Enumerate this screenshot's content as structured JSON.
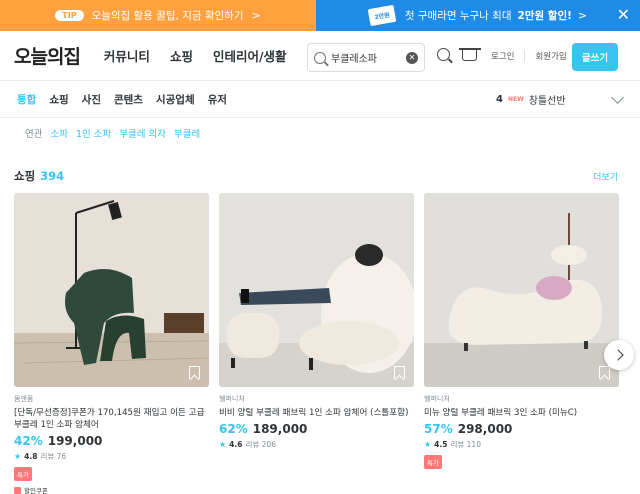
{
  "banners": {
    "left": {
      "tip": "TIP",
      "text": "오늘의집 활용 꿀팁, 지금 확인하기",
      "chevron": ">"
    },
    "right": {
      "coupon_label": "2만원",
      "text": "첫 구매라면 누구나 최대 ",
      "highlight": "2만원 할인!",
      "chevron": ">",
      "close": "✕"
    }
  },
  "header": {
    "logo": "오늘의집",
    "nav": [
      "커뮤니티",
      "쇼핑",
      "인테리어/생활"
    ],
    "search": {
      "value": "부클레소파",
      "clear": "✕"
    },
    "login": "로그인",
    "signup": "회원가입",
    "write_button": "글쓰기"
  },
  "tabs": {
    "items": [
      "통합",
      "쇼핑",
      "사진",
      "콘텐츠",
      "시공업체",
      "유저"
    ],
    "active_index": 0,
    "trending": {
      "rank": "4",
      "new_label": "NEW",
      "keyword": "창틀선반"
    }
  },
  "related": {
    "label": "연관",
    "keywords": [
      "소파",
      "1인 소파",
      "부클레 의자",
      "부클레"
    ]
  },
  "shopping": {
    "title": "쇼핑",
    "count": "394",
    "more": "더보기",
    "products": [
      {
        "brand": "몸앤몸",
        "name": "[단독/무선증정]쿠폰가 170,145원 재입고 이든 고급 부클레 1인 소파 암체어",
        "discount": "42%",
        "price": "199,000",
        "rating": "4.8",
        "reviews": "리뷰 76",
        "badge": "특가",
        "coupon": "할인쿠폰"
      },
      {
        "brand": "웰퍼니처",
        "name": "비비 양털 부클레 패브릭 1인 소파 암체어 (스툴포함)",
        "discount": "62%",
        "price": "189,000",
        "rating": "4.6",
        "reviews": "리뷰 206"
      },
      {
        "brand": "웰퍼니처",
        "name": "미뉴 양털 부클레 패브릭 3인 소파 (미뉴C)",
        "discount": "57%",
        "price": "298,000",
        "rating": "4.5",
        "reviews": "리뷰 110",
        "badge": "특가"
      }
    ]
  },
  "colors": {
    "accent": "#35c5f0",
    "banner_orange": "#ffa13f",
    "banner_blue": "#1f8be6",
    "sale_badge": "#ff7777"
  }
}
